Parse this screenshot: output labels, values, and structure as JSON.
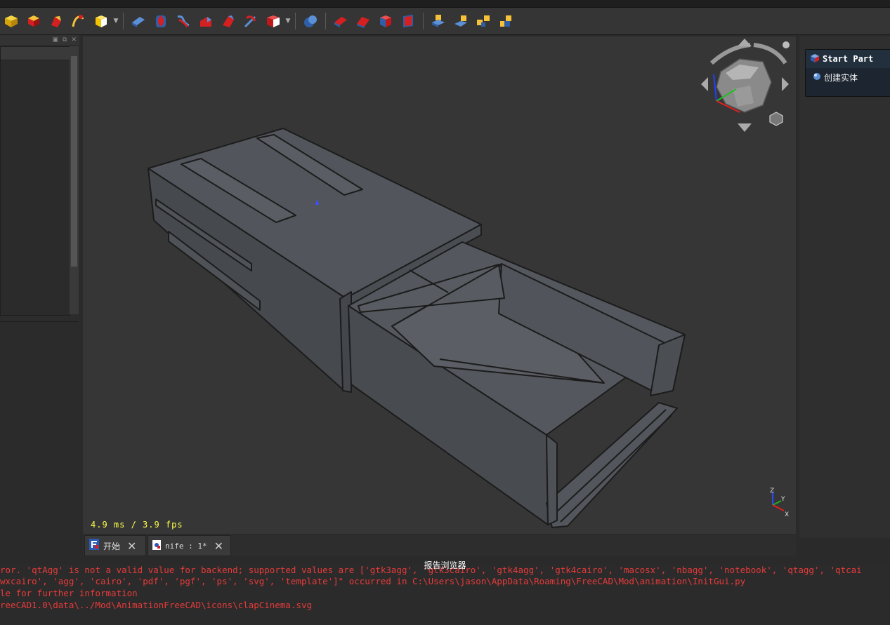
{
  "toolbar": {
    "icons": [
      "cube-yellow",
      "box-red",
      "cylinder-red",
      "sphere-yellow",
      "cube-dropdown",
      "cone-blue",
      "torus-blue",
      "helix-red",
      "prism-red",
      "wedge-red",
      "boolean-blue",
      "part-dropdown",
      "union-blue",
      "cut-red",
      "intersect-red",
      "fuse-red",
      "chamfer-red",
      "extrude-blue",
      "revolve-blue",
      "mirror-yellow",
      "loft-yellow"
    ]
  },
  "viewport": {
    "fps_text": "4.9 ms / 3.9 fps",
    "axes": {
      "z": "Z",
      "y": "Y",
      "x": "X"
    }
  },
  "task_panel": {
    "title": "Start Part",
    "item": "创建实体"
  },
  "tabs": [
    {
      "label": "开始",
      "close": "✕"
    },
    {
      "label": "nife : 1*",
      "close": "✕"
    }
  ],
  "report": {
    "title": "报告浏览器",
    "lines": [
      "ror. 'qtAgg' is not a valid value for backend; supported values are ['gtk3agg', 'gtk3cairo', 'gtk4agg', 'gtk4cairo', 'macosx', 'nbagg', 'notebook', 'qtagg', 'qtcai",
      "wxcairo', 'agg', 'cairo', 'pdf', 'pgf', 'ps', 'svg', 'template']\" occurred in C:\\Users\\jason\\AppData\\Roaming\\FreeCAD\\Mod\\animation\\InitGui.py",
      "le for further information",
      "reeCAD1.0\\data\\../Mod\\AnimationFreeCAD\\icons\\clapCinema.svg"
    ]
  },
  "colors": {
    "viewport_bg": "#363636",
    "model_face": "#4d5056",
    "fps_text": "#ffff4a",
    "report_error": "#e83a3a",
    "task_header": "#22303e"
  }
}
